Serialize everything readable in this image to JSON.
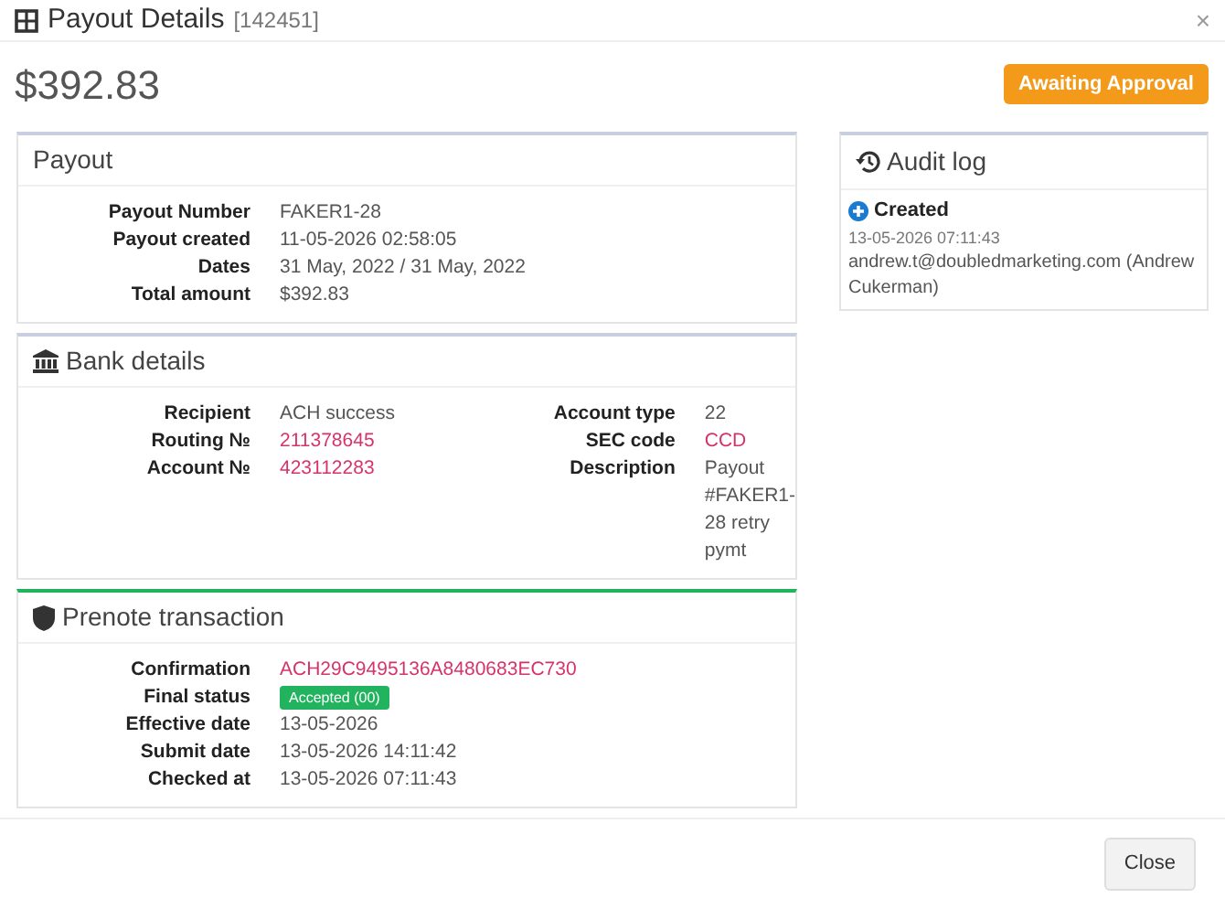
{
  "window": {
    "title": "Payout Details",
    "id": "[142451]",
    "close": "×"
  },
  "amount": "$392.83",
  "status_badge": "Awaiting Approval",
  "sections": [
    {
      "title": "Payout",
      "color": "#c9cfe0",
      "columns": [
        [
          {
            "label": "Payout Number",
            "value": "FAKER1-28",
            "kind": "text"
          },
          {
            "label": "Payout created",
            "value": "11-05-2026 02:58:05",
            "kind": "text"
          },
          {
            "label": "Dates",
            "value": "31 May, 2022 / 31 May, 2022",
            "kind": "text"
          },
          {
            "label": "Total amount",
            "value": "$392.83",
            "kind": "text"
          }
        ]
      ]
    },
    {
      "title": "Bank details",
      "color": "#c9cfe0",
      "columns": [
        [
          {
            "label": "Recipient",
            "value": "ACH success",
            "kind": "text"
          },
          {
            "label": "Routing №",
            "value": "211378645",
            "kind": "code"
          },
          {
            "label": "Account №",
            "value": "423112283",
            "kind": "code"
          }
        ],
        [
          {
            "label": "Account type",
            "value": "22",
            "kind": "text"
          },
          {
            "label": "SEC code",
            "value": "CCD",
            "kind": "code"
          },
          {
            "label": "Description",
            "value": "Payout #FAKER1-28 retry pymt",
            "kind": "text"
          }
        ]
      ]
    },
    {
      "title": "Prenote transaction",
      "color": "#22b35e",
      "columns": [
        [
          {
            "label": "Confirmation",
            "value": "ACH29C9495136A8480683EC730",
            "kind": "code"
          },
          {
            "label": "Final status",
            "value": "Accepted (00)",
            "kind": "badge"
          },
          {
            "label": "Effective date",
            "value": "13-05-2026",
            "kind": "text"
          },
          {
            "label": "Submit date",
            "value": "13-05-2026 14:11:42",
            "kind": "text"
          },
          {
            "label": "Checked at",
            "value": "13-05-2026 07:11:43",
            "kind": "text"
          }
        ]
      ]
    }
  ],
  "audit_log": {
    "title": "Audit log",
    "entries": [
      {
        "event": "Created",
        "time": "13-05-2026 07:11:43",
        "user": "andrew.t@doubledmarketing.com (Andrew Cukerman)"
      }
    ]
  },
  "footer": {
    "button": "Close"
  }
}
